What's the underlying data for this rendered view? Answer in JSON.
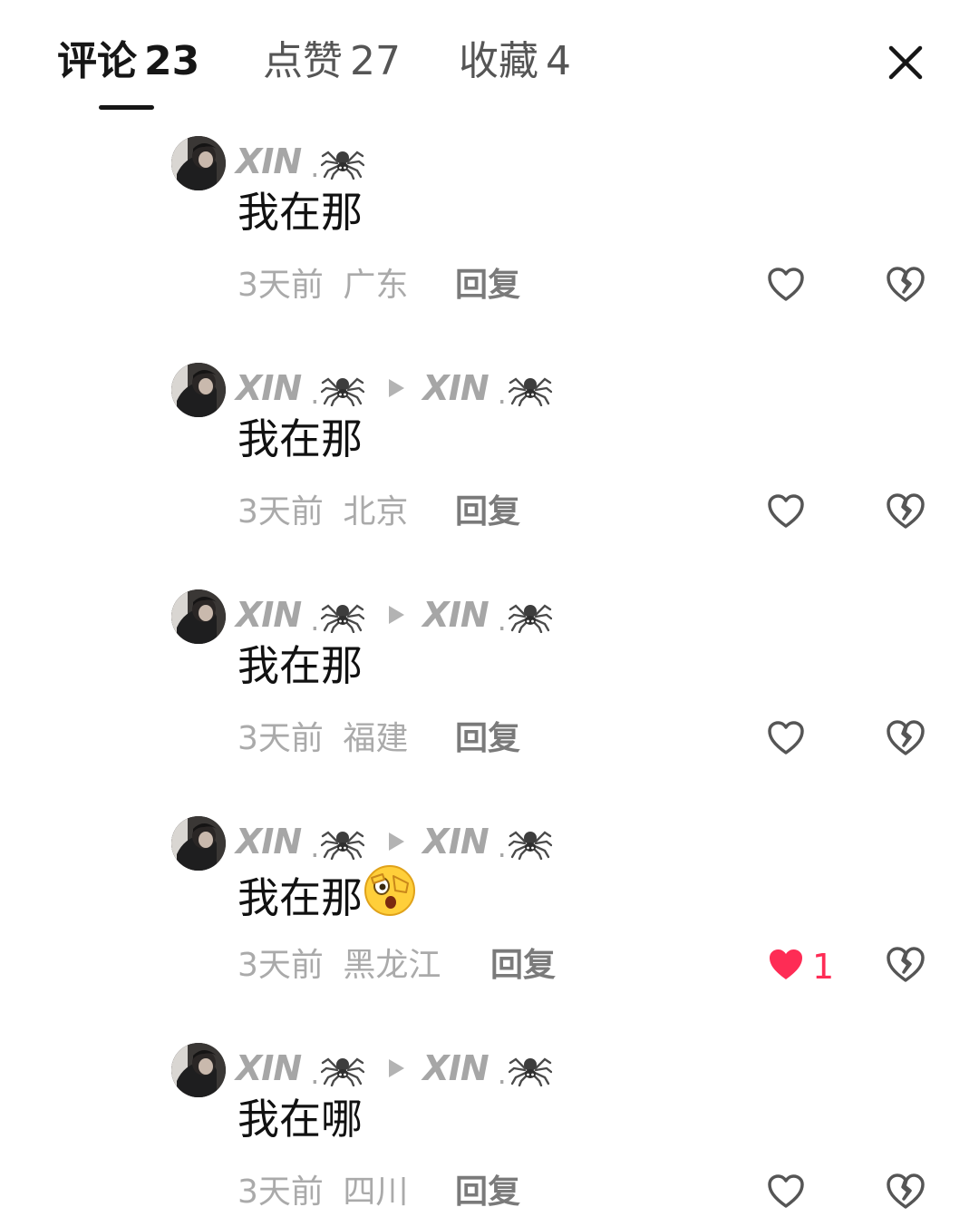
{
  "tabs": [
    {
      "label": "评论",
      "count": "23",
      "active": true
    },
    {
      "label": "点赞",
      "count": "27",
      "active": false
    },
    {
      "label": "收藏",
      "count": "4",
      "active": false
    }
  ],
  "close_icon": "close-icon",
  "reply_label": "回复",
  "colors": {
    "liked": "#fe2c55",
    "muted": "#a6a6a6",
    "text": "#111111"
  },
  "comments": [
    {
      "author": "XIN",
      "sep": ".",
      "reply_to": null,
      "text": "我在那",
      "emoji": null,
      "time": "3天前",
      "location": "广东",
      "liked": false,
      "likes": ""
    },
    {
      "author": "XIN",
      "sep": ".",
      "reply_to": "XIN",
      "reply_sep": ".",
      "text": "我在那",
      "emoji": null,
      "time": "3天前",
      "location": "北京",
      "liked": false,
      "likes": ""
    },
    {
      "author": "XIN",
      "sep": ".",
      "reply_to": "XIN",
      "reply_sep": ".",
      "text": "我在那",
      "emoji": null,
      "time": "3天前",
      "location": "福建",
      "liked": false,
      "likes": ""
    },
    {
      "author": "XIN",
      "sep": ".",
      "reply_to": "XIN",
      "reply_sep": ".",
      "text": "我在那",
      "emoji": "shocked-peek-emoji",
      "time": "3天前",
      "location": "黑龙江",
      "liked": true,
      "likes": "1"
    },
    {
      "author": "XIN",
      "sep": ".",
      "reply_to": "XIN",
      "reply_sep": ".",
      "text": "我在哪",
      "emoji": null,
      "time": "3天前",
      "location": "四川",
      "liked": false,
      "likes": ""
    }
  ]
}
